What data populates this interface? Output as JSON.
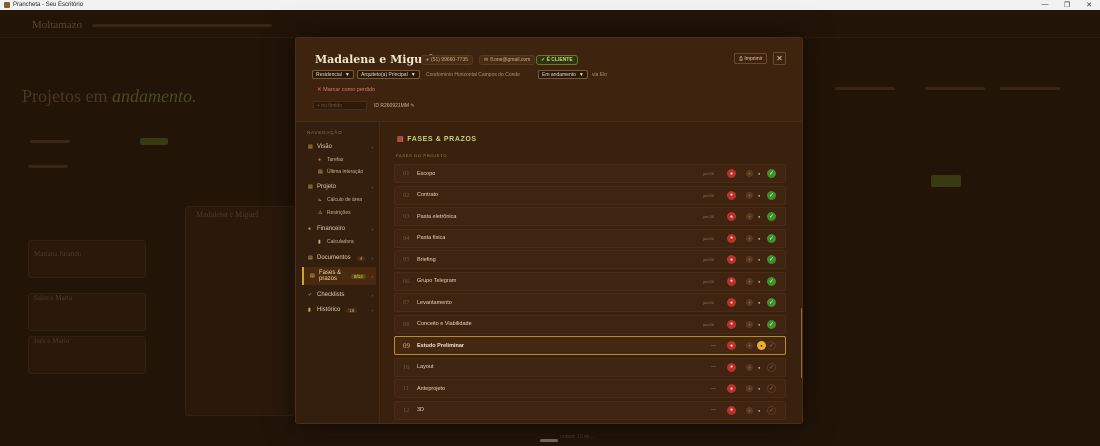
{
  "window": {
    "title": "Prancheta - Seu Escritório",
    "controls": [
      "—",
      "❐",
      "✕"
    ]
  },
  "background": {
    "logo": "Moltamazo",
    "page_title_prefix": "Projetos em",
    "page_title_accent": "andamento.",
    "card_names": [
      "Madalena e Miguel",
      "Mariana Jurando",
      "Sales e Marta",
      "Inês e Mario"
    ],
    "footer_hint": "ordem: 10 de ..."
  },
  "modal": {
    "client_name": "Madalena e Miguel",
    "phone": "(51) 99660-7735",
    "email": "fl.one@gmail.com",
    "client_badge": "✓ É CLIENTE",
    "print_label": "⎙ Imprimir",
    "close_label": "✕",
    "type_select": "Residencial",
    "architect_select": "Arquiteto(a) Principal",
    "address": "Condomínio Horizontal Campos do Conde",
    "status_select": "Em andamento",
    "via": "via Elo",
    "mark_lost": "✕ Marcar como perdido",
    "mini_input_placeholder": "+ ou tímido",
    "project_id": "ID R260921MM ✎"
  },
  "sidebar": {
    "heading": "NAVEGAÇÃO",
    "items": [
      {
        "label": "Visão",
        "icon": "eye-icon",
        "glyph": "▤",
        "arrow": "›"
      },
      {
        "label": "Tarefas",
        "icon": "tasks-icon",
        "glyph": "●"
      },
      {
        "label": "Última interação",
        "icon": "chat-icon",
        "glyph": "▤"
      },
      {
        "label": "Projeto",
        "icon": "folder-icon",
        "glyph": "▤",
        "arrow": "›"
      },
      {
        "label": "Cálculo de área",
        "icon": "ruler-icon",
        "glyph": "⊾"
      },
      {
        "label": "Restrições",
        "icon": "warning-icon",
        "glyph": "⚠"
      },
      {
        "label": "Financeiro",
        "icon": "money-icon",
        "glyph": "●",
        "arrow": "›"
      },
      {
        "label": "Calculadora",
        "icon": "calculator-icon",
        "glyph": "▮"
      },
      {
        "label": "Documentos",
        "icon": "document-icon",
        "glyph": "▤",
        "count": "4",
        "arrow": "›"
      },
      {
        "label": "Fases & prazos",
        "icon": "calendar-icon",
        "glyph": "▤",
        "count": "8/14",
        "arrow": "›"
      },
      {
        "label": "Checklists",
        "icon": "checklist-icon",
        "glyph": "✔",
        "arrow": "›"
      },
      {
        "label": "Histórico",
        "icon": "history-icon",
        "glyph": "▮",
        "count": "16",
        "arrow": "›"
      }
    ]
  },
  "content": {
    "section_icon": "▤",
    "section_title": "FASES & PRAZOS",
    "section_subtitle": "FASES DO PROJETO",
    "phases": [
      {
        "num": "01",
        "name": "Escopo",
        "date": "jun/26",
        "done": true,
        "current": false
      },
      {
        "num": "02",
        "name": "Contrato",
        "date": "jun/26",
        "done": true,
        "current": false
      },
      {
        "num": "03",
        "name": "Pasta eletrônica",
        "date": "jun/26",
        "done": true,
        "current": false
      },
      {
        "num": "04",
        "name": "Pasta física",
        "date": "jun/26",
        "done": true,
        "current": false
      },
      {
        "num": "05",
        "name": "Briefing",
        "date": "jun/26",
        "done": true,
        "current": false
      },
      {
        "num": "06",
        "name": "Grupo Telegram",
        "date": "jun/26",
        "done": true,
        "current": false
      },
      {
        "num": "07",
        "name": "Levantamento",
        "date": "jun/26",
        "done": true,
        "current": false
      },
      {
        "num": "08",
        "name": "Conceito e Viabilidade",
        "date": "jun/26",
        "done": true,
        "current": false
      },
      {
        "num": "09",
        "name": "Estudo Preliminar",
        "date": "—",
        "done": false,
        "current": true
      },
      {
        "num": "10",
        "name": "Layout",
        "date": "—",
        "done": false,
        "current": false
      },
      {
        "num": "11",
        "name": "Anteprojeto",
        "date": "—",
        "done": false,
        "current": false
      },
      {
        "num": "12",
        "name": "3D",
        "date": "—",
        "done": false,
        "current": false
      }
    ]
  },
  "colors": {
    "accent": "#c9a92a",
    "done": "#3f8f2a",
    "danger": "#b8322a",
    "current": "#e6b030"
  }
}
